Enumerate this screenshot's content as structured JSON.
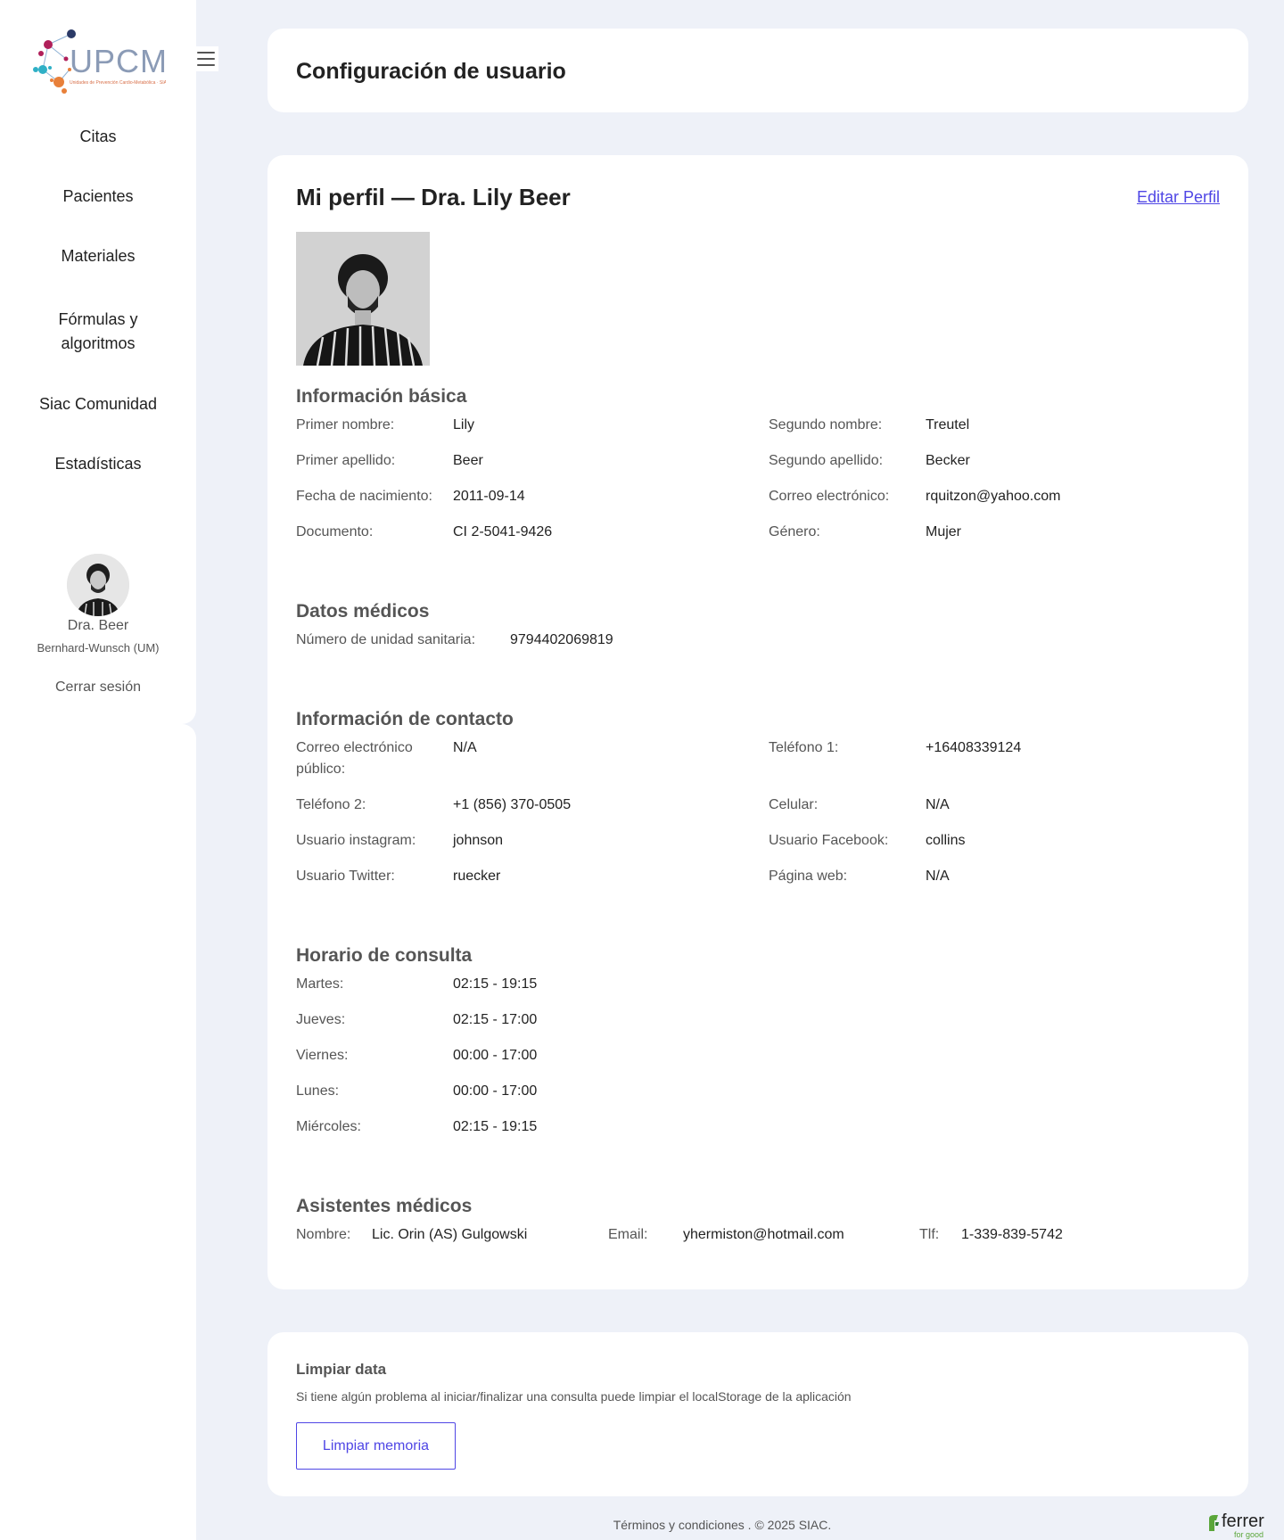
{
  "app": {
    "logo_text": "UPCM",
    "logo_subtitle": "Unidades de Prevención Cardio-Metabólica · SIAC"
  },
  "sidebar": {
    "items": [
      {
        "label": "Citas"
      },
      {
        "label": "Pacientes"
      },
      {
        "label": "Materiales"
      },
      {
        "label": "Fórmulas y algoritmos"
      },
      {
        "label": "Siac Comunidad"
      },
      {
        "label": "Estadísticas"
      }
    ],
    "user_name": "Dra. Beer",
    "user_org": "Bernhard-Wunsch (UM)",
    "logout_label": "Cerrar sesión"
  },
  "header": {
    "title": "Configuración de usuario"
  },
  "profile": {
    "title": "Mi perfil — Dra. Lily Beer",
    "edit_label": "Editar Perfil",
    "basic": {
      "title": "Información básica",
      "first_name_label": "Primer nombre:",
      "first_name": "Lily",
      "middle_name_label": "Segundo nombre:",
      "middle_name": "Treutel",
      "last_name_label": "Primer apellido:",
      "last_name": "Beer",
      "second_last_name_label": "Segundo apellido:",
      "second_last_name": "Becker",
      "birth_label": "Fecha de nacimiento:",
      "birth": "2011-09-14",
      "email_label": "Correo electrónico:",
      "email": "rquitzon@yahoo.com",
      "document_label": "Documento:",
      "document": "CI 2-5041-9426",
      "gender_label": "Género:",
      "gender": "Mujer"
    },
    "medical": {
      "title": "Datos médicos",
      "unit_label": "Número de unidad sanitaria:",
      "unit": "9794402069819"
    },
    "contact": {
      "title": "Información de contacto",
      "public_email_label": "Correo electrónico público:",
      "public_email": "N/A",
      "phone1_label": "Teléfono 1:",
      "phone1": "+16408339124",
      "phone2_label": "Teléfono 2:",
      "phone2": "+1 (856) 370-0505",
      "mobile_label": "Celular:",
      "mobile": "N/A",
      "instagram_label": "Usuario instagram:",
      "instagram": "johnson",
      "facebook_label": "Usuario Facebook:",
      "facebook": "collins",
      "twitter_label": "Usuario Twitter:",
      "twitter": "ruecker",
      "web_label": "Página web:",
      "web": "N/A"
    },
    "schedule": {
      "title": "Horario de consulta",
      "rows": [
        {
          "day": "Martes:",
          "hours": "02:15 - 19:15"
        },
        {
          "day": "Jueves:",
          "hours": "02:15 - 17:00"
        },
        {
          "day": "Viernes:",
          "hours": "00:00 - 17:00"
        },
        {
          "day": "Lunes:",
          "hours": "00:00 - 17:00"
        },
        {
          "day": "Miércoles:",
          "hours": "02:15 - 19:15"
        }
      ]
    },
    "assistants": {
      "title": "Asistentes médicos",
      "name_label": "Nombre:",
      "name": "Lic. Orin (AS) Gulgowski",
      "email_label": "Email:",
      "email": "yhermiston@hotmail.com",
      "phone_label": "Tlf:",
      "phone": "1-339-839-5742"
    }
  },
  "clean": {
    "title": "Limpiar data",
    "description": "Si tiene algún problema al iniciar/finalizar una consulta puede limpiar el localStorage de la aplicación",
    "button_label": "Limpiar memoria"
  },
  "footer": {
    "text": "Términos y condiciones . © 2025 SIAC.",
    "brand": "ferrer",
    "brand_tagline": "for good"
  },
  "colors": {
    "accent": "#4f46e5",
    "page_bg": "#eef1f8",
    "brand_green": "#5aa63a"
  }
}
